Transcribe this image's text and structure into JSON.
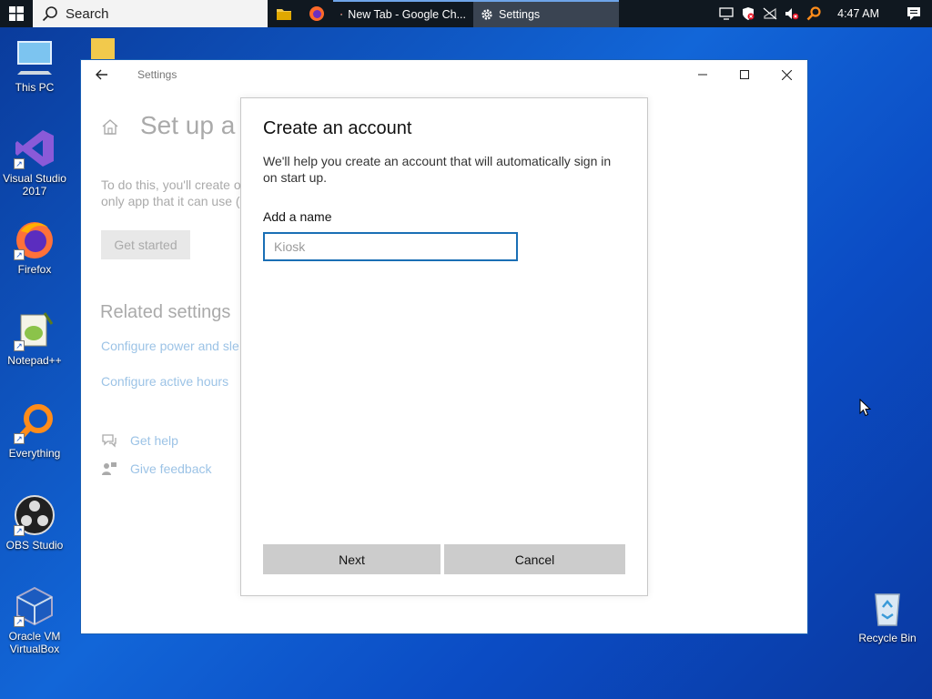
{
  "taskbar": {
    "search_text": "Search",
    "tasks": [
      {
        "label": "New Tab - Google Ch..."
      },
      {
        "label": "Settings"
      }
    ],
    "clock": "4:47 AM"
  },
  "desktop": {
    "icons": [
      {
        "label": "This PC"
      },
      {
        "label": "Visual Studio 2017"
      },
      {
        "label": "Firefox"
      },
      {
        "label": "Notepad++"
      },
      {
        "label": "Everything"
      },
      {
        "label": "OBS Studio"
      },
      {
        "label": "Oracle VM VirtualBox"
      },
      {
        "label": "Recycle Bin"
      }
    ]
  },
  "window": {
    "title": "Settings",
    "page_title": "Set up a k",
    "desc_line1": "To do this, you'll create o",
    "desc_line2": "only app that it can use (",
    "get_started": "Get started",
    "related_heading": "Related settings",
    "related_links": [
      "Configure power and sle",
      "Configure active hours"
    ],
    "help": "Get help",
    "feedback": "Give feedback"
  },
  "dialog": {
    "title": "Create an account",
    "description": "We'll help you create an account that will automatically sign in on start up.",
    "name_label": "Add a name",
    "name_placeholder": "Kiosk",
    "name_value": "",
    "next_label": "Next",
    "cancel_label": "Cancel"
  },
  "colors": {
    "accent": "#1a6fb5",
    "link_disabled": "#9cc3e6",
    "button_gray": "#cccccc",
    "taskbar": "#101820"
  }
}
